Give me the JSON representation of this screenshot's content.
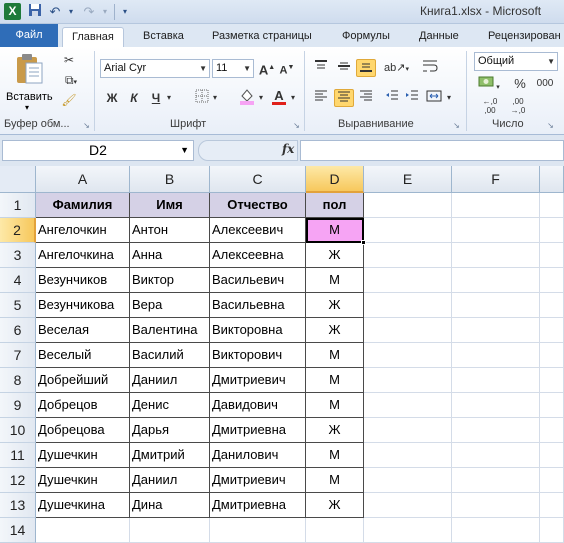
{
  "app": {
    "logo_letter": "X",
    "title": "Книга1.xlsx - Microsoft"
  },
  "tabs": [
    "Файл",
    "Главная",
    "Вставка",
    "Разметка страницы",
    "Формулы",
    "Данные",
    "Рецензирован"
  ],
  "ribbon": {
    "paste_label": "Вставить",
    "font_name": "Arial Cyr",
    "font_size": "11",
    "bold": "Ж",
    "italic": "К",
    "underline": "Ч",
    "number_format": "Общий",
    "percent": "%",
    "thousands": "000",
    "groups": {
      "clipboard": "Буфер обм...",
      "font": "Шрифт",
      "alignment": "Выравнивание",
      "number": "Число"
    }
  },
  "formula_bar": {
    "name_box": "D2",
    "fx": "fx",
    "formula": ""
  },
  "sheet": {
    "columns": [
      "A",
      "B",
      "C",
      "D",
      "E",
      "F"
    ],
    "rows": [
      "1",
      "2",
      "3",
      "4",
      "5",
      "6",
      "7",
      "8",
      "9",
      "10",
      "11",
      "12",
      "13",
      "14"
    ],
    "selected_cell": "D2",
    "header": [
      "Фамилия",
      "Имя",
      "Отчество",
      "пол"
    ],
    "data": [
      [
        "Ангелочкин",
        "Антон",
        "Алексеевич",
        "М"
      ],
      [
        "Ангелочкина",
        "Анна",
        "Алексеевна",
        "Ж"
      ],
      [
        "Везунчиков",
        "Виктор",
        "Васильевич",
        "М"
      ],
      [
        "Везунчикова",
        "Вера",
        "Васильевна",
        "Ж"
      ],
      [
        "Веселая",
        "Валентина",
        "Викторовна",
        "Ж"
      ],
      [
        "Веселый",
        "Василий",
        "Викторович",
        "М"
      ],
      [
        "Добрейший",
        "Даниил",
        "Дмитриевич",
        "М"
      ],
      [
        "Добрецов",
        "Денис",
        "Давидович",
        "М"
      ],
      [
        "Добрецова",
        "Дарья",
        "Дмитриевна",
        "Ж"
      ],
      [
        "Душечкин",
        "Дмитрий",
        "Данилович",
        "М"
      ],
      [
        "Душечкин",
        "Даниил",
        "Дмитриевич",
        "М"
      ],
      [
        "Душечкина",
        "Дина",
        "Дмитриевна",
        "Ж"
      ]
    ],
    "colors": {
      "header_fill": "#d5d1e6",
      "active_fill": "#f6a4f4",
      "selection_accent": "#f7c85c"
    }
  }
}
